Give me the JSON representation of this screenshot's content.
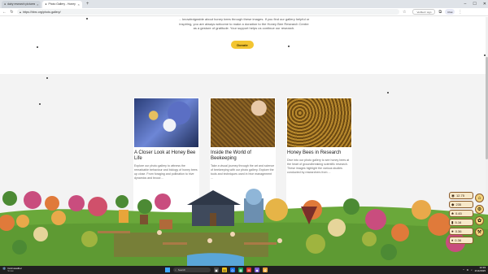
{
  "browser": {
    "tabs": [
      {
        "title": "dairy research pictures - Search",
        "active": false
      },
      {
        "title": "Photo Gallery - Honey Bee Resea",
        "active": true
      }
    ],
    "new_tab": "+",
    "url": "https://hbrc.org/photo-gallery/",
    "right_box": "Verified / sign",
    "profile": "Chat"
  },
  "page": {
    "donate_text": "... knowledgeable about honey bees through these images. If you find our gallery helpful or inspiring, you are always welcome to make a donation to the Honey Bee Research Centre as a gesture of gratitude. Your support helps us continue our research.",
    "donate_label": "Donate",
    "cards": [
      {
        "title": "A Closer Look at Honey Bee Life",
        "text": "Explore our photo gallery to witness the remarkable behaviour and biology of honey bees up close. From foraging and pollination to hive dynamics and brood ..."
      },
      {
        "title": "Inside the World of Beekeeping",
        "text": "Take a visual journey through the art and science of beekeeping with our photo gallery. Explore the tools and techniques used in hive management ..."
      },
      {
        "title": "Honey Bees in Research",
        "text": "Dive into our photo gallery to see honey bees at the heart of groundbreaking scientific research. These images highlight the various studies conducted by researchers from ..."
      }
    ]
  },
  "game": {
    "hud": [
      {
        "icon": "coin-icon",
        "value": "12.75"
      },
      {
        "icon": "gem-icon",
        "value": "235"
      },
      {
        "icon": "leaf-icon",
        "value": "0.45"
      },
      {
        "icon": "wood-icon",
        "value": "5.16"
      },
      {
        "icon": "stone-icon",
        "value": "0.36"
      },
      {
        "icon": "food-icon",
        "value": "0.36"
      }
    ]
  },
  "taskbar": {
    "weather_temp": "Cold weather",
    "weather_sub": "Snow",
    "search_placeholder": "Search",
    "time": "12:19",
    "date": "2/14/2025"
  }
}
